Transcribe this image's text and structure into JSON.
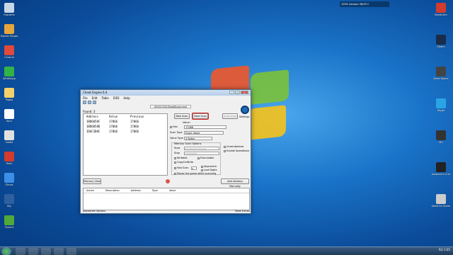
{
  "desktop": {
    "left_icons": [
      {
        "label": "Корзина",
        "color": "#c7d7e6"
      },
      {
        "label": "Кураж Кадри",
        "color": "#e8a53a"
      },
      {
        "label": "Chrome",
        "color": "#e04a3b"
      },
      {
        "label": "WhatsApp",
        "color": "#31b446"
      },
      {
        "label": "Papka",
        "color": "#f2d16b"
      },
      {
        "label": "docs",
        "color": "#ffffff"
      },
      {
        "label": "media",
        "color": "#e0e0e0"
      },
      {
        "label": "Helix",
        "color": "#d23b2e"
      },
      {
        "label": "iTunes",
        "color": "#3d8ee8"
      },
      {
        "label": "Sky",
        "color": "#2e5f9e"
      },
      {
        "label": "Torrent",
        "color": "#50a83a"
      }
    ],
    "right_icons": [
      {
        "label": "Bandicam",
        "color": "#d23b2e"
      },
      {
        "label": "Steam",
        "color": "#1b2b4a"
      },
      {
        "label": "Dead Space",
        "color": "#444444"
      },
      {
        "label": "Skype",
        "color": "#2aa4e6"
      },
      {
        "label": "MU",
        "color": "#333333"
      },
      {
        "label": "Assassin's Creed",
        "color": "#222222"
      },
      {
        "label": "Need for Speed",
        "color": "#cccccc"
      }
    ],
    "widget_text": "100%  Samara 38/35 C"
  },
  "window": {
    "title": "Cheat Engine 6.4",
    "controls": [
      "–",
      "□",
      "✕"
    ],
    "menu": [
      "File",
      "Edit",
      "Table",
      "D3D",
      "Help"
    ],
    "process": "00001328-DeadSpace.exe",
    "found": "Found: 3",
    "columns": [
      "Address",
      "Value",
      "Previous"
    ],
    "rows": [
      {
        "address": "1BD6858C",
        "value": "17066",
        "previous": "17066"
      },
      {
        "address": "1BD6858D",
        "value": "17066",
        "previous": "17066"
      },
      {
        "address": "1D6C3D0C",
        "value": "17066",
        "previous": "17066"
      }
    ],
    "new_scan": "New Scan",
    "next_scan": "Next Scan",
    "undo_scan": "Undo Scan",
    "settings": "Settings",
    "value_label": "Value:",
    "hex_label": "Hex",
    "value_input": "17066",
    "scan_type_label": "Scan Type",
    "scan_type": "Exact Value",
    "value_type_label": "Value Type",
    "value_type": "4 Bytes",
    "memory_options_label": "Memory Scan Options",
    "start_label": "Start",
    "start_value": "0000000000000000",
    "stop_label": "Stop",
    "stop_value": "7fffffffffffffff",
    "unrandomizer": "Unrandomizer",
    "speedhack": "Enable Speedhack",
    "writable": "Writable",
    "executable": "Executable",
    "copyonwrite": "CopyOnWrite",
    "fast_scan": "Fast Scan",
    "fast_scan_value": "4",
    "alignment": "Alignment",
    "last_digits": "Last Digits",
    "pause": "Pause the game while scanning",
    "memory_view": "Memory View",
    "add_manually": "Add Address Manually",
    "addr_columns": [
      "Active",
      "Description",
      "Address",
      "Type",
      "Value"
    ],
    "advanced": "Advanced Options",
    "table_extras": "Table Extras"
  },
  "taskbar": {
    "clock": "RU  1:05"
  }
}
